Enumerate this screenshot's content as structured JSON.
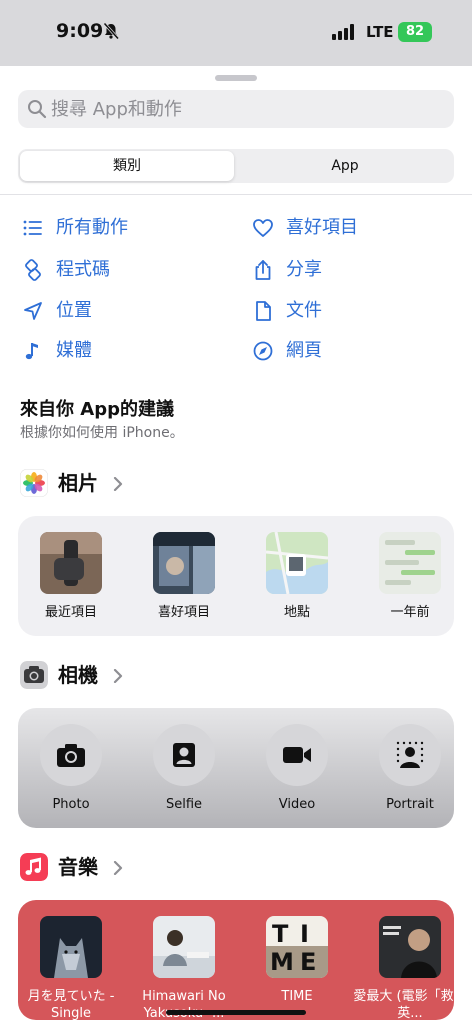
{
  "status_bar": {
    "time": "9:09",
    "network": "LTE",
    "battery": "82"
  },
  "search": {
    "placeholder": "搜尋 App和動作"
  },
  "segments": [
    {
      "label": "類別"
    },
    {
      "label": "App"
    }
  ],
  "categories": [
    {
      "label": "所有動作",
      "icon": "list-icon"
    },
    {
      "label": "喜好項目",
      "icon": "heart-icon"
    },
    {
      "label": "程式碼",
      "icon": "code-icon"
    },
    {
      "label": "分享",
      "icon": "share-icon"
    },
    {
      "label": "位置",
      "icon": "location-arrow-icon"
    },
    {
      "label": "文件",
      "icon": "document-icon"
    },
    {
      "label": "媒體",
      "icon": "music-note-icon"
    },
    {
      "label": "網頁",
      "icon": "compass-icon"
    }
  ],
  "suggestions": {
    "title": "來自你 App的建議",
    "subtitle": "根據你如何使用 iPhone。"
  },
  "apps": [
    {
      "name": "相片",
      "items": [
        {
          "label": "最近項目"
        },
        {
          "label": "喜好項目"
        },
        {
          "label": "地點"
        },
        {
          "label": "一年前"
        }
      ]
    },
    {
      "name": "相機",
      "items": [
        {
          "label": "Photo",
          "icon": "camera-icon"
        },
        {
          "label": "Selfie",
          "icon": "selfie-icon"
        },
        {
          "label": "Video",
          "icon": "video-camera-icon"
        },
        {
          "label": "Portrait",
          "icon": "portrait-icon"
        }
      ]
    },
    {
      "name": "音樂",
      "items": [
        {
          "label": "月を見ていた - Single"
        },
        {
          "label": "Himawari No Yakusoku -..."
        },
        {
          "label": "TIME"
        },
        {
          "label": "愛最大 (電影「救火英..."
        }
      ]
    }
  ],
  "colors": {
    "accent": "#2f6fd6",
    "battery": "#34c759",
    "music_card": "#d5565a"
  }
}
